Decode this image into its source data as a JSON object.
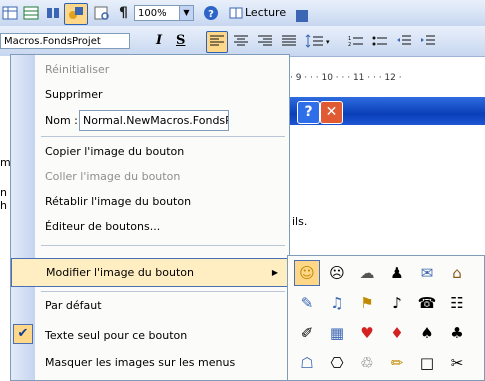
{
  "toolbar_top": {
    "zoom_value": "100%",
    "read_label": "Lecture"
  },
  "toolbar_format": {
    "style_value": "Macros.FondsProjet"
  },
  "ruler": {
    "text": "· 9 · · · 10 · · · 11 · · · 12 ·"
  },
  "dialog": {
    "help_glyph": "?",
    "close_glyph": "✕",
    "body_text": "ils."
  },
  "left_strip": [
    "m",
    "n",
    "h"
  ],
  "menu": {
    "items": [
      {
        "label": "Réinitialiser",
        "enabled": false
      },
      {
        "label": "Supprimer",
        "enabled": true
      },
      {
        "label": "Nom :",
        "value": "Normal.NewMacros.FondsPro"
      },
      {
        "label": "Copier l'image du bouton",
        "enabled": true
      },
      {
        "label": "Coller l'image du bouton",
        "enabled": false
      },
      {
        "label": "Rétablir l'image du bouton",
        "enabled": true
      },
      {
        "label": "Éditeur de boutons...",
        "enabled": true
      },
      {
        "label": "Modifier l'image du bouton",
        "enabled": true,
        "highlighted": true,
        "submenu": "▶"
      },
      {
        "label": "Par défaut",
        "enabled": true
      },
      {
        "label": "Texte seul pour ce bouton",
        "enabled": true,
        "checked": true
      },
      {
        "label": "Masquer les images sur les menus",
        "enabled": true
      }
    ],
    "check_glyph": "✔"
  },
  "palette": {
    "rows": [
      [
        "☺",
        "☹",
        "☁",
        "♟",
        "✉",
        "⌂"
      ],
      [
        "✎",
        "♫",
        "⚑",
        "♪",
        "☎",
        "☷"
      ],
      [
        "✐",
        "▦",
        "♥",
        "♦",
        "♠",
        "♣"
      ],
      [
        "☖",
        "⎔",
        "♲",
        "✏",
        "□",
        "✂"
      ]
    ],
    "selected": "☺"
  }
}
